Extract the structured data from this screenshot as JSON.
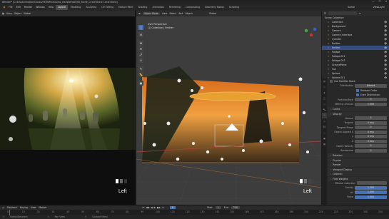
{
  "app": {
    "title": "Blender* [C:\\Info\\Animation\\Class\\VFX\\ReFinal\\Class_Hex\\Blender\\06_Stone_Circle\\Stone Circle.blend]",
    "window_controls": [
      "—",
      "☐",
      "✕"
    ]
  },
  "menu": {
    "items": [
      "File",
      "Edit",
      "Render",
      "Window",
      "Help"
    ],
    "workspace_tabs": [
      "Layout",
      "Modeling",
      "Sculpting",
      "UV Editing",
      "Texture Paint",
      "Shading",
      "Animation",
      "Rendering",
      "Compositing",
      "Geometry Nodes",
      "Scripting"
    ],
    "active_tab": "Layout",
    "scene_label": "Scene",
    "viewlayer_label": "ViewLayer"
  },
  "left_view": {
    "header_items": [
      "View",
      "Object",
      "Global"
    ],
    "corner_label": "Left"
  },
  "mid_view": {
    "mode": "Object Mode",
    "header_items": [
      "View",
      "Select",
      "Add",
      "Object"
    ],
    "transform_label": "Global",
    "overlay_title": "User Perspective",
    "overlay_collection": "(1) Collection | Emitter",
    "corner_label": "Left"
  },
  "outliner": {
    "title": "Scene Collection",
    "items": [
      {
        "name": "Collection",
        "selected": false
      },
      {
        "name": "Background",
        "selected": false
      },
      {
        "name": "Camera",
        "selected": false
      },
      {
        "name": "Camera_Interface",
        "selected": false
      },
      {
        "name": "Cylinder",
        "selected": false
      },
      {
        "name": "Emitter",
        "selected": false
      },
      {
        "name": "Emitter",
        "selected": true
      },
      {
        "name": "Foliage",
        "selected": false
      },
      {
        "name": "Foliage.001",
        "selected": false
      },
      {
        "name": "Foliage.002",
        "selected": false
      },
      {
        "name": "GroundPlane",
        "selected": false
      },
      {
        "name": "Sun",
        "selected": false
      },
      {
        "name": "Sphere",
        "selected": false
      },
      {
        "name": "Sphere.001",
        "selected": false
      },
      {
        "name": "Sphere.002",
        "selected": false
      }
    ]
  },
  "properties": {
    "header_field": "Use Modifier Stack",
    "distribution_label": "Distribution",
    "distribution_value": "Jittered",
    "checkbox_random": "Random Order",
    "checkbox_even": "Even Distribution",
    "particles_face_label": "Particles/Face",
    "particles_face_value": "0",
    "jittering_label": "Jittering Amount",
    "jittering_value": "1.000",
    "sections_top": [
      "Cache",
      "Velocity"
    ],
    "velocity_rows": [
      {
        "label": "Normal",
        "value": "3"
      },
      {
        "label": "Tangent",
        "value": "0 m/s"
      },
      {
        "label": "Tangent Phase",
        "value": "0"
      },
      {
        "label": "Object Aligned X",
        "value": "0 m/s"
      },
      {
        "label": "Y",
        "value": "0 m/s"
      },
      {
        "label": "Z",
        "value": "0 m/s"
      },
      {
        "label": "Object Velocity",
        "value": "0"
      },
      {
        "label": "Randomize",
        "value": "0"
      }
    ],
    "sections_bottom": [
      "Rotation",
      "Physics",
      "Render",
      "Viewport Display",
      "Children",
      "Field Weights"
    ],
    "field_weights": {
      "effector_label": "Effector Collection",
      "rows": [
        {
          "label": "Gravity",
          "value": "1.000"
        },
        {
          "label": "All",
          "value": "1.000"
        },
        {
          "label": "Force",
          "value": "1.000"
        }
      ]
    }
  },
  "timeline": {
    "menu": [
      "Playback",
      "Keying",
      "View",
      "Marker"
    ],
    "frame_marks": [
      "0",
      "10",
      "20",
      "30",
      "40",
      "50",
      "60",
      "70",
      "80",
      "90",
      "100",
      "110",
      "120",
      "130",
      "140",
      "150",
      "160",
      "170",
      "180",
      "190",
      "200",
      "210",
      "220",
      "230",
      "240",
      "250"
    ],
    "current_frame": "1",
    "start_label": "Start",
    "start_value": "1",
    "end_label": "End",
    "end_value": "250",
    "status_left": "Select/Deselect",
    "status_mid": "Pan View",
    "status_right": "Context Menu"
  },
  "colors": {
    "accent": "#4772b3",
    "selection": "#334d80",
    "playhead": "#e06020"
  }
}
